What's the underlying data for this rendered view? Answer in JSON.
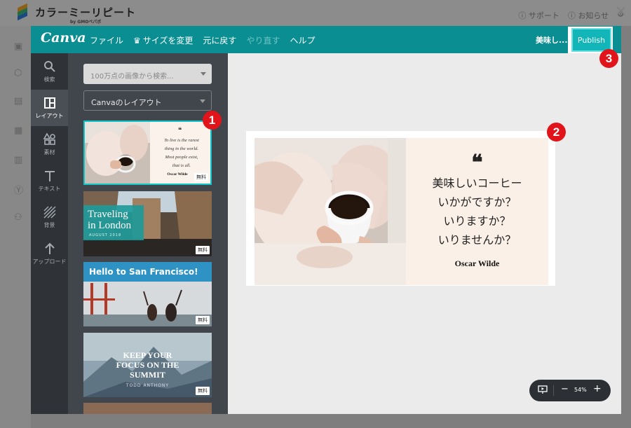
{
  "background_app": {
    "brand": "カラーミーリピート",
    "brand_sub": "by GMOペパボ",
    "links": [
      "サポート",
      "お知らせ"
    ]
  },
  "topbar": {
    "logo": "Canva",
    "menu": [
      "ファイル",
      "サイズを変更",
      "元に戻す",
      "やり直す",
      "ヘルプ"
    ],
    "title": "美味し...",
    "publish_label": "Publish"
  },
  "iconbar": {
    "items": [
      {
        "label": "検索",
        "icon": "search-icon"
      },
      {
        "label": "レイアウト",
        "icon": "layout-icon",
        "active": true
      },
      {
        "label": "素材",
        "icon": "elements-icon"
      },
      {
        "label": "テキスト",
        "icon": "text-icon"
      },
      {
        "label": "背景",
        "icon": "background-icon"
      },
      {
        "label": "アップロード",
        "icon": "upload-icon"
      }
    ]
  },
  "panel": {
    "search_placeholder": "100万点の画像から検索...",
    "dropdown_value": "Canvaのレイアウト",
    "free_label": "無料",
    "thumbs": [
      {
        "quote_mark": "❝",
        "lines": [
          "To live is the rarest",
          "thing in the world.",
          "Most people exist,",
          "that is all."
        ],
        "author": "Oscar Wilde"
      },
      {
        "title_1": "Traveling",
        "title_2": "in London",
        "sub": "AUGUST 2018"
      },
      {
        "title": "Hello to San Francisco!"
      },
      {
        "lines": [
          "KEEP YOUR",
          "FOCUS ON THE",
          "SUMMIT"
        ],
        "sub": "TODD ANTHONY"
      }
    ]
  },
  "design": {
    "quote_mark": "❝",
    "lines": [
      "美味しいコーヒー",
      "いかがですか？",
      "いりますか？",
      "いりませんか？"
    ],
    "author": "Oscar Wilde"
  },
  "zoom": {
    "level": "54%",
    "minus": "−",
    "plus": "+"
  },
  "badges": [
    "1",
    "2",
    "3"
  ],
  "colors": {
    "brand": "#0a8e91",
    "publish": "#12b5b8",
    "badge": "#e0141a",
    "panel": "#41464c",
    "iconbar": "#2f3338"
  }
}
